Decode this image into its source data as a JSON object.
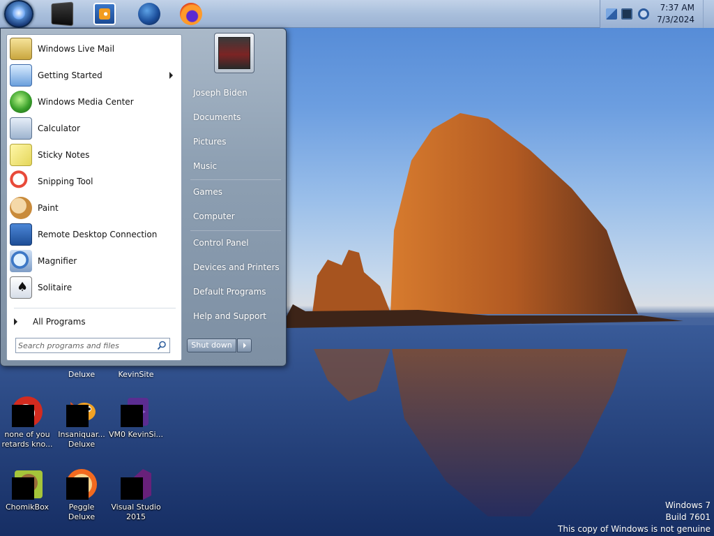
{
  "taskbar": {
    "pinned": [
      {
        "name": "command-prompt-icon"
      },
      {
        "name": "windows-media-player-icon"
      },
      {
        "name": "globe-icon"
      },
      {
        "name": "firefox-icon"
      }
    ],
    "clock": {
      "time": "7:37 AM",
      "date": "7/3/2024"
    }
  },
  "start_menu": {
    "programs": [
      {
        "label": "Windows Live Mail",
        "icon": "mail-icon",
        "submenu": false
      },
      {
        "label": "Getting Started",
        "icon": "getting-started-icon",
        "submenu": true
      },
      {
        "label": "Windows Media Center",
        "icon": "media-center-icon",
        "submenu": false
      },
      {
        "label": "Calculator",
        "icon": "calculator-icon",
        "submenu": false
      },
      {
        "label": "Sticky Notes",
        "icon": "sticky-notes-icon",
        "submenu": false
      },
      {
        "label": "Snipping Tool",
        "icon": "scissors-icon",
        "submenu": false
      },
      {
        "label": "Paint",
        "icon": "palette-icon",
        "submenu": false
      },
      {
        "label": "Remote Desktop Connection",
        "icon": "remote-desktop-icon",
        "submenu": false
      },
      {
        "label": "Magnifier",
        "icon": "magnifier-icon",
        "submenu": false
      },
      {
        "label": "Solitaire",
        "icon": "playing-card-icon",
        "submenu": false
      }
    ],
    "all_programs": "All Programs",
    "search_placeholder": "Search programs and files",
    "right_items": [
      "Joseph Biden",
      "Documents",
      "Pictures",
      "Music",
      "Games",
      "Computer",
      "Control Panel",
      "Devices and Printers",
      "Default Programs",
      "Help and Support"
    ],
    "shutdown_label": "Shut down"
  },
  "desktop": {
    "icons": [
      {
        "label": "none of you retards kno...",
        "icon": "red-circle-app-icon"
      },
      {
        "label": "Insaniquar... Deluxe",
        "icon": "fish-game-icon"
      },
      {
        "label": "VM0 KevinSi...",
        "icon": "visual-studio-icon"
      },
      {
        "label": "ChomikBox",
        "icon": "hamster-icon"
      },
      {
        "label": "Peggle Deluxe",
        "icon": "peggle-icon"
      },
      {
        "label": "Visual Studio 2015",
        "icon": "visual-studio-icon"
      }
    ],
    "partial_labels": [
      "Deluxe",
      "KevinSite"
    ]
  },
  "watermark": {
    "line1": "Windows 7",
    "line2": "Build 7601",
    "line3": "This copy of Windows is not genuine"
  },
  "colors": {
    "taskbar": "#a9bfdc",
    "start_menu": "#8ea0b3",
    "accent_green": "#1fd13a"
  }
}
